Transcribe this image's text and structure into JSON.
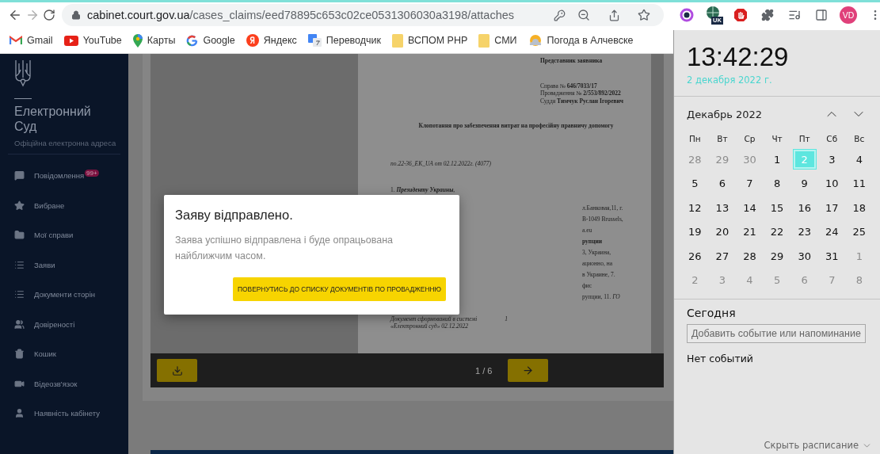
{
  "browser": {
    "back_disabled": false,
    "forward_disabled": true,
    "url_host": "cabinet.court.gov.ua",
    "url_path": "/cases_claims/eed78895c653c02ce0531306030a3198/attaches",
    "translate_badge": "UK",
    "profile_initials": "VD"
  },
  "bookmarks": [
    {
      "label": "Gmail"
    },
    {
      "label": "YouTube"
    },
    {
      "label": "Карты"
    },
    {
      "label": "Google"
    },
    {
      "label": "Яндекс"
    },
    {
      "label": "Переводчик"
    },
    {
      "label": "ВСПОМ РНР"
    },
    {
      "label": "СМИ"
    },
    {
      "label": "Погода в Алчевске"
    }
  ],
  "sidebar": {
    "title": "Електронний Суд",
    "subtitle": "Офіційна електронна адреса",
    "items": [
      {
        "label": "Повідомлення",
        "badge": "99+"
      },
      {
        "label": "Вибране"
      },
      {
        "label": "Мої справи"
      },
      {
        "label": "Заяви"
      },
      {
        "label": "Документи сторін"
      },
      {
        "label": "Довіреності"
      },
      {
        "label": "Кошик"
      },
      {
        "label": "Відеозв'язок"
      },
      {
        "label": "Наявність кабінету"
      }
    ]
  },
  "document": {
    "blocks": [
      {
        "kind": "heading",
        "lines": [
          "Представник заявника"
        ]
      },
      {
        "kind": "case",
        "lines": [
          "Справа № **646/7033/17**",
          "Провадження № **2/553/892/2022**",
          "Суддя **Тимчук Руслан Ігоревич**"
        ]
      },
      {
        "kind": "title",
        "lines": [
          "Клопотання про забезпечення витрат на професійну правничу допомогу"
        ]
      },
      {
        "kind": "ref",
        "lines": [
          "*по.22-36_EK_UA* от 02.12.2022г. (*4077*)"
        ]
      },
      {
        "kind": "item",
        "lines": [
          "1. **Президенту Украины**,"
        ]
      },
      {
        "kind": "fragments",
        "lines": [
          "л.Банковая,11, г.",
          "B-1049 Brussels,",
          "a.eu",
          "**рупции**",
          "3, Украина,",
          "ационно, на",
          "в Украине, 7.",
          "фис",
          "рупции, 11. *ГО*"
        ]
      },
      {
        "kind": "footer",
        "lines": [
          "Документ сформований в системі",
          "«Електронний суд» 02.12.2022"
        ],
        "page_mark": "1"
      }
    ],
    "page_counter": "1 / 6"
  },
  "modal": {
    "title": "Заяву відправлено.",
    "message": "Заява успішно відправлена і буде опрацьована найближчим часом.",
    "button": "ПОВЕРНУТИСЬ ДО СПИСКУ ДОКУМЕНТІВ ПО ПРОВАДЖЕННЮ"
  },
  "calendar": {
    "time": "13:42:29",
    "date": "2 декабря 2022 г.",
    "month": "Декабрь 2022",
    "weekdays": [
      "Пн",
      "Вт",
      "Ср",
      "Чт",
      "Пт",
      "Сб",
      "Вс"
    ],
    "weeks": [
      [
        {
          "day": "28",
          "other_month": true,
          "selected": false
        },
        {
          "day": "29",
          "other_month": true,
          "selected": false
        },
        {
          "day": "30",
          "other_month": true,
          "selected": false
        },
        {
          "day": "1",
          "other_month": false,
          "selected": false
        },
        {
          "day": "2",
          "other_month": false,
          "selected": true
        },
        {
          "day": "3",
          "other_month": false,
          "selected": false
        },
        {
          "day": "4",
          "other_month": false,
          "selected": false
        }
      ],
      [
        {
          "day": "5",
          "other_month": false,
          "selected": false
        },
        {
          "day": "6",
          "other_month": false,
          "selected": false
        },
        {
          "day": "7",
          "other_month": false,
          "selected": false
        },
        {
          "day": "8",
          "other_month": false,
          "selected": false
        },
        {
          "day": "9",
          "other_month": false,
          "selected": false
        },
        {
          "day": "10",
          "other_month": false,
          "selected": false
        },
        {
          "day": "11",
          "other_month": false,
          "selected": false
        }
      ],
      [
        {
          "day": "12",
          "other_month": false,
          "selected": false
        },
        {
          "day": "13",
          "other_month": false,
          "selected": false
        },
        {
          "day": "14",
          "other_month": false,
          "selected": false
        },
        {
          "day": "15",
          "other_month": false,
          "selected": false
        },
        {
          "day": "16",
          "other_month": false,
          "selected": false
        },
        {
          "day": "17",
          "other_month": false,
          "selected": false
        },
        {
          "day": "18",
          "other_month": false,
          "selected": false
        }
      ],
      [
        {
          "day": "19",
          "other_month": false,
          "selected": false
        },
        {
          "day": "20",
          "other_month": false,
          "selected": false
        },
        {
          "day": "21",
          "other_month": false,
          "selected": false
        },
        {
          "day": "22",
          "other_month": false,
          "selected": false
        },
        {
          "day": "23",
          "other_month": false,
          "selected": false
        },
        {
          "day": "24",
          "other_month": false,
          "selected": false
        },
        {
          "day": "25",
          "other_month": false,
          "selected": false
        }
      ],
      [
        {
          "day": "26",
          "other_month": false,
          "selected": false
        },
        {
          "day": "27",
          "other_month": false,
          "selected": false
        },
        {
          "day": "28",
          "other_month": false,
          "selected": false
        },
        {
          "day": "29",
          "other_month": false,
          "selected": false
        },
        {
          "day": "30",
          "other_month": false,
          "selected": false
        },
        {
          "day": "31",
          "other_month": false,
          "selected": false
        },
        {
          "day": "1",
          "other_month": true,
          "selected": false
        }
      ],
      [
        {
          "day": "2",
          "other_month": true,
          "selected": false
        },
        {
          "day": "3",
          "other_month": true,
          "selected": false
        },
        {
          "day": "4",
          "other_month": true,
          "selected": false
        },
        {
          "day": "5",
          "other_month": true,
          "selected": false
        },
        {
          "day": "6",
          "other_month": true,
          "selected": false
        },
        {
          "day": "7",
          "other_month": true,
          "selected": false
        },
        {
          "day": "8",
          "other_month": true,
          "selected": false
        }
      ]
    ],
    "today_label": "Сегодня",
    "event_placeholder": "Добавить событие или напоминание",
    "no_events": "Нет событий",
    "hide_label": "Скрыть расписание"
  }
}
